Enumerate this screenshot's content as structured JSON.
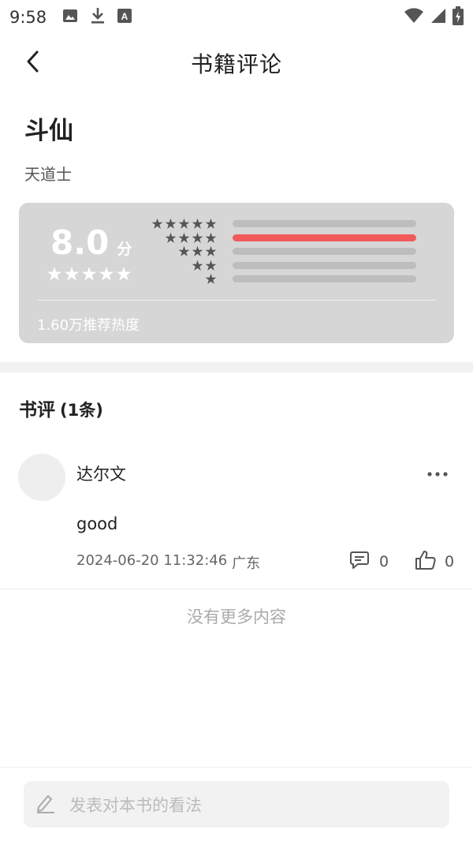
{
  "status_bar": {
    "time": "9:58",
    "left_icons": [
      "image-icon",
      "download-icon",
      "text-a-icon"
    ],
    "right_icons": [
      "wifi-icon",
      "signal-icon",
      "battery-charging-icon"
    ]
  },
  "header": {
    "title": "书籍评论",
    "back_icon": "chevron-left-icon"
  },
  "book": {
    "title": "斗仙",
    "author": "天道士"
  },
  "rating": {
    "score": "8.0",
    "unit": "分",
    "stars_filled": 5,
    "distribution": [
      {
        "stars": 5,
        "fraction": 0.0
      },
      {
        "stars": 4,
        "fraction": 1.0
      },
      {
        "stars": 3,
        "fraction": 0.0
      },
      {
        "stars": 2,
        "fraction": 0.0
      },
      {
        "stars": 1,
        "fraction": 0.0
      }
    ],
    "heat": "1.60万推荐热度",
    "colors": {
      "card": "#d6d6d6",
      "bar_fill": "#f25a5a",
      "bar_track": "#bdbdbd",
      "dist_star": "#555555"
    }
  },
  "reviews": {
    "heading": "书评",
    "count_label": "(1条)",
    "items": [
      {
        "name": "达尔文",
        "text": "good",
        "datetime": "2024-06-20 11:32:46",
        "location": "广东",
        "comment_count": "0",
        "like_count": "0"
      }
    ],
    "no_more": "没有更多内容"
  },
  "composer": {
    "placeholder": "发表对本书的看法",
    "icon": "pencil-icon"
  }
}
